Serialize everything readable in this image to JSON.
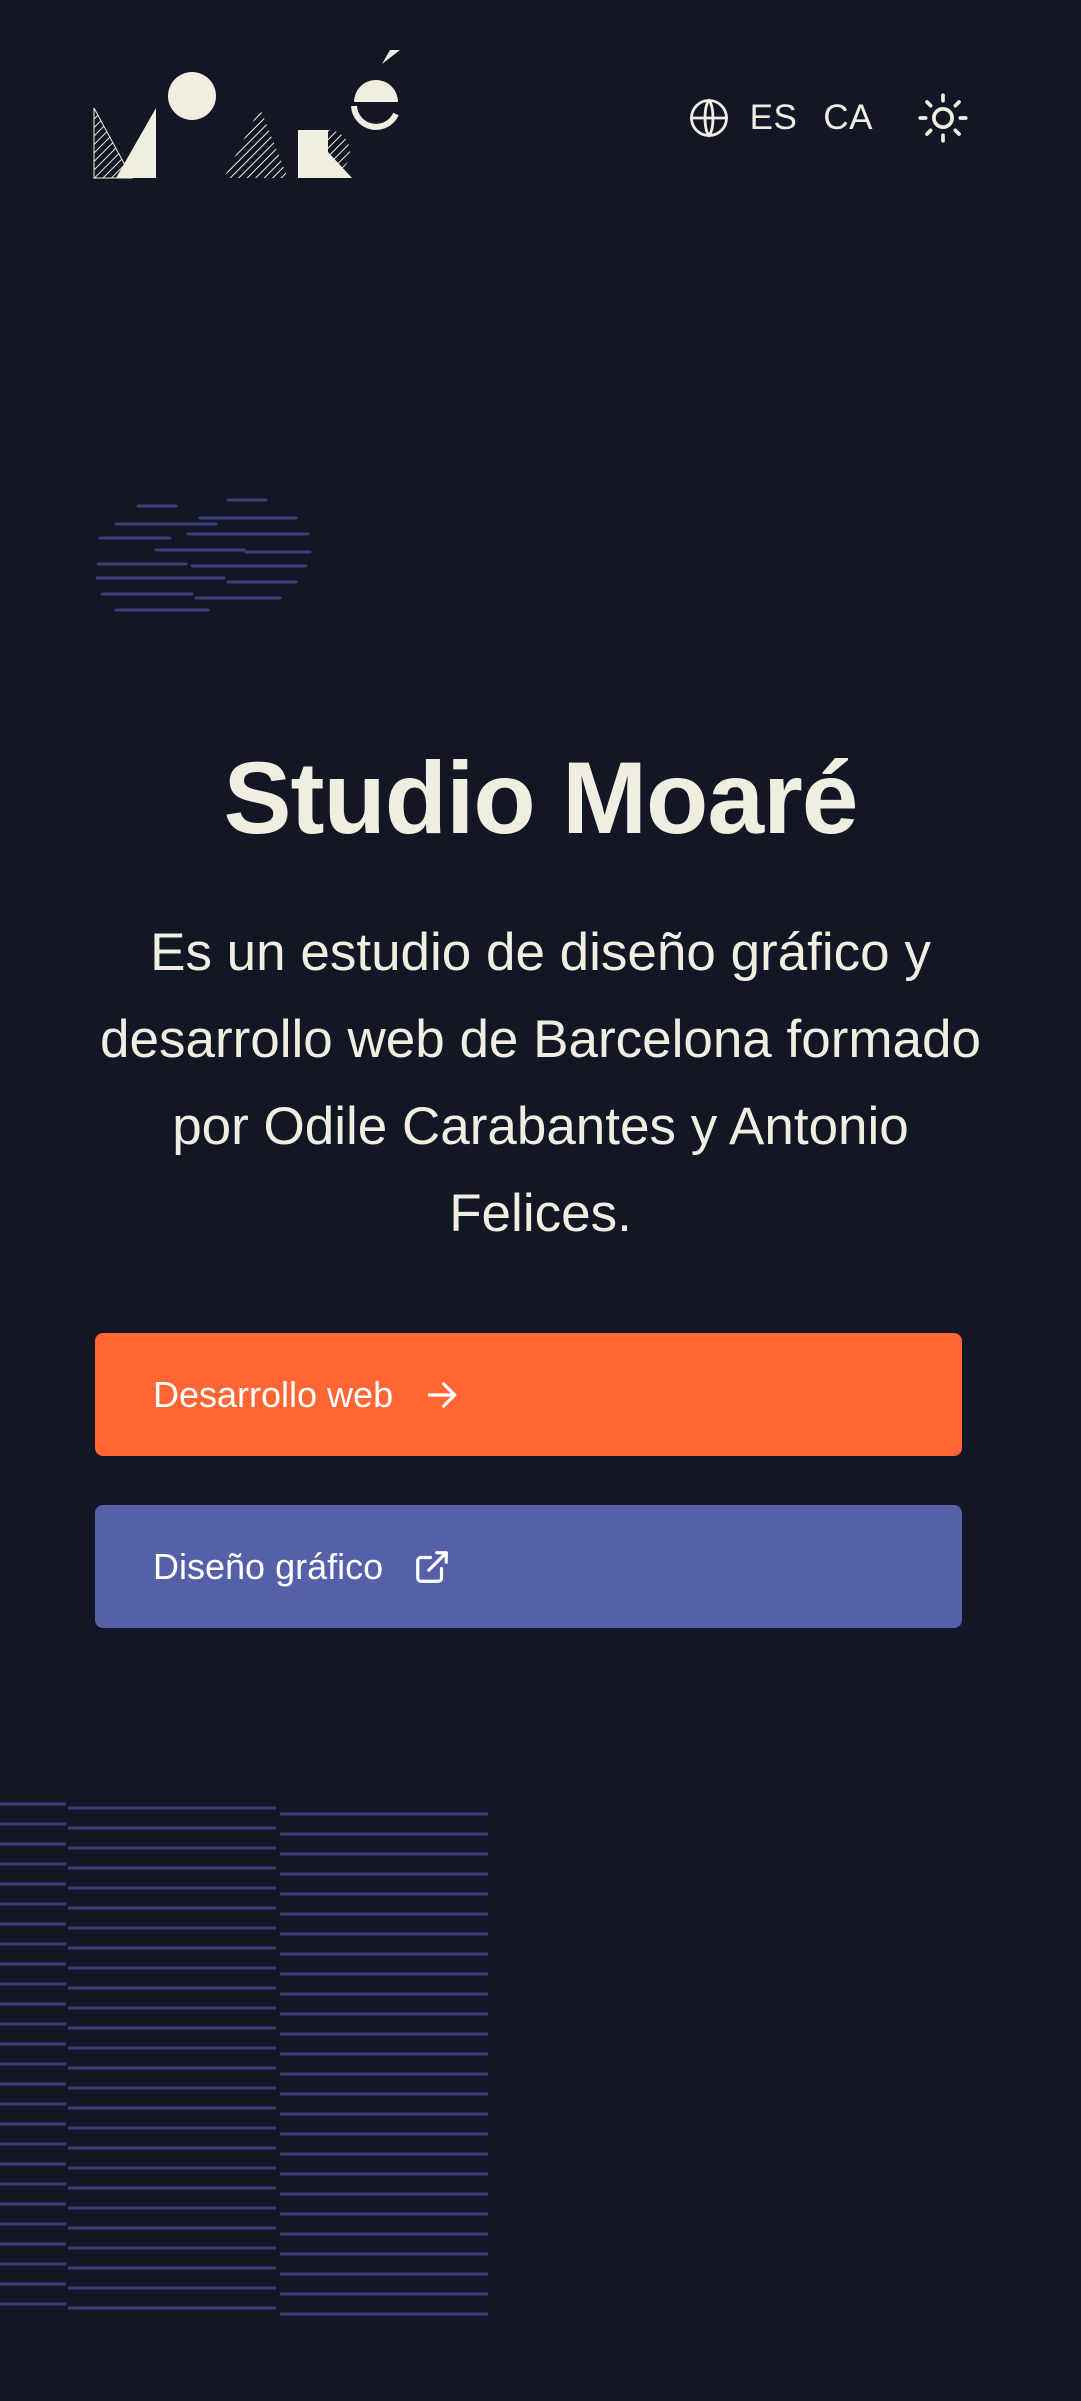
{
  "header": {
    "logo_alt": "Moaré",
    "languages": [
      {
        "code": "ES",
        "label": "ES"
      },
      {
        "code": "CA",
        "label": "CA"
      }
    ],
    "icons": {
      "language": "globe-icon",
      "theme_toggle": "sun-icon"
    }
  },
  "hero": {
    "title": "Studio Moaré",
    "description": "Es un estudio de diseño gráfico y desarrollo web de Barcelona formado por Odile Carabantes y Antonio Felices."
  },
  "actions": [
    {
      "label": "Desarrollo web",
      "icon": "arrow-right-icon",
      "color": "#ff6633"
    },
    {
      "label": "Diseño gráfico",
      "icon": "external-link-icon",
      "color": "#5660a8"
    }
  ],
  "colors": {
    "background": "#131625",
    "text": "#efeee1",
    "accent_orange": "#ff6633",
    "accent_purple": "#5660a8",
    "decoration_lines": "#3b3d78"
  }
}
